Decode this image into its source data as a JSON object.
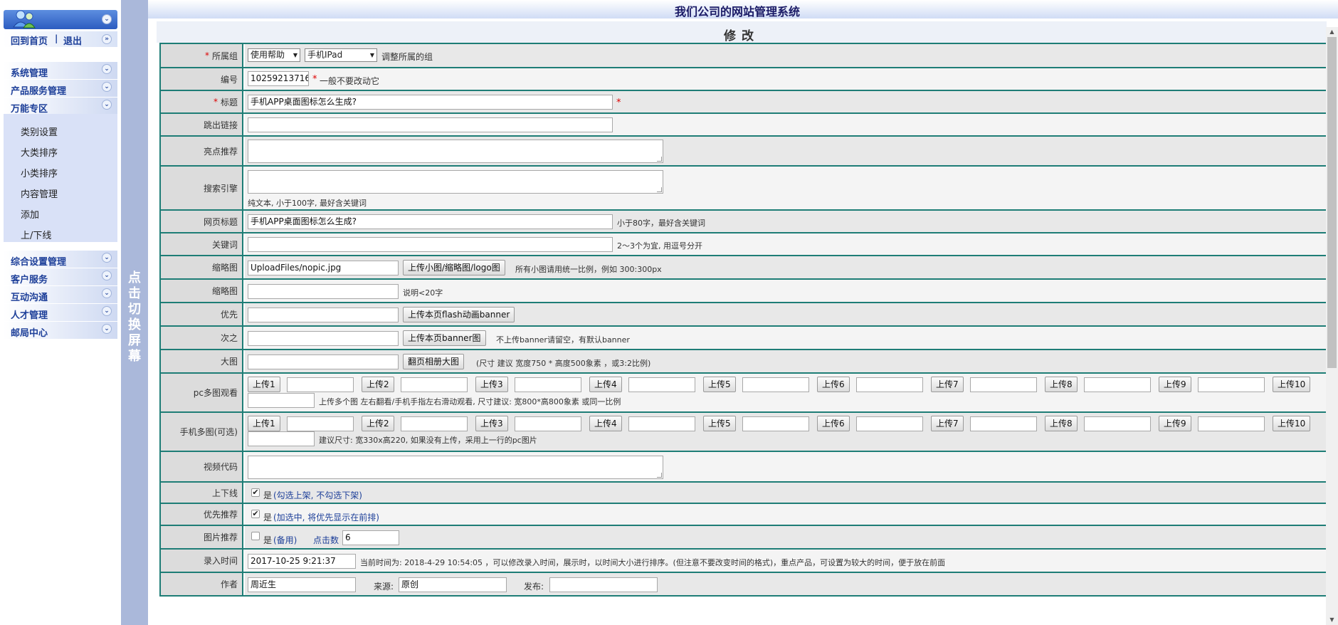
{
  "sidebar": {
    "back_home": "回到首页",
    "sep": "|",
    "logout": "退出",
    "menus": [
      "系统管理",
      "产品服务管理",
      "万能专区"
    ],
    "sub_items": [
      "类别设置",
      "大类排序",
      "小类排序",
      "内容管理",
      "添加",
      "上/下线"
    ],
    "menus2": [
      "综合设置管理",
      "客户服务",
      "互动沟通",
      "人才管理",
      "邮局中心"
    ],
    "toggle_glyph": "»"
  },
  "splitter": {
    "label": "点击切换屏幕"
  },
  "header": {
    "title": "我们公司的网站管理系统",
    "subtitle": "修改"
  },
  "form": {
    "group": {
      "label": "所属组",
      "select1": "使用帮助",
      "select2": "手机IPad",
      "note": "调整所属的组"
    },
    "code": {
      "label": "编号",
      "value": "10259213716",
      "note": "一般不要改动它"
    },
    "title": {
      "label": "标题",
      "value": "手机APP桌面图标怎么生成?"
    },
    "jump": {
      "label": "跳出链接",
      "value": ""
    },
    "highlight": {
      "label": "亮点推荐"
    },
    "seo": {
      "label": "搜索引擎",
      "note": "纯文本, 小于100字, 最好含关键词"
    },
    "page_title": {
      "label": "网页标题",
      "value": "手机APP桌面图标怎么生成?",
      "note": "小于80字，最好含关键词"
    },
    "keywords": {
      "label": "关键词",
      "value": "",
      "note": "2～3个为宜, 用逗号分开"
    },
    "thumb": {
      "label": "缩略图",
      "value": "UploadFiles/nopic.jpg",
      "button": "上传小图/缩略图/logo图",
      "note": "所有小图请用统一比例，例如 300:300px"
    },
    "thumb2": {
      "label": "缩略图",
      "value": "",
      "note": "说明<20字"
    },
    "first": {
      "label": "优先",
      "value": "",
      "button": "上传本页flash动画banner"
    },
    "second": {
      "label": "次之",
      "value": "",
      "button": "上传本页banner图",
      "note": "不上传banner请留空，有默认banner"
    },
    "big": {
      "label": "大图",
      "value": "",
      "button": "翻页相册大图",
      "note": "(尺寸 建议 宽度750 * 高度500象素 ，或3:2比例)"
    },
    "pc_multi": {
      "label": "pc多图观看",
      "buttons": [
        "上传1",
        "上传2",
        "上传3",
        "上传4",
        "上传5",
        "上传6",
        "上传7",
        "上传8",
        "上传9",
        "上传10"
      ],
      "note": "上传多个图 左右翻看/手机手指左右滑动观看, 尺寸建议: 宽800*高800象素 或同一比例"
    },
    "mobile_multi": {
      "label": "手机多图(可选)",
      "buttons": [
        "上传1",
        "上传2",
        "上传3",
        "上传4",
        "上传5",
        "上传6",
        "上传7",
        "上传8",
        "上传9",
        "上传10"
      ],
      "note": "建议尺寸: 宽330x高220, 如果没有上传，采用上一行的pc图片"
    },
    "video": {
      "label": "视频代码"
    },
    "online": {
      "label": "上下线",
      "checked": true,
      "yes": "是",
      "hint": "(勾选上架, 不勾选下架)"
    },
    "priority": {
      "label": "优先推荐",
      "checked": true,
      "yes": "是",
      "hint": "(加选中, 将优先显示在前排)"
    },
    "pic_rec": {
      "label": "图片推荐",
      "checked": false,
      "yes": "是",
      "hint": "(备用)",
      "clicks_label": "点击数",
      "clicks": "6"
    },
    "entry_time": {
      "label": "录入时间",
      "value": "2017-10-25 9:21:37",
      "note": "当前时间为: 2018-4-29 10:54:05 ，可以修改录入时间，展示时，以时间大小进行排序。(但注意不要改变时间的格式)，重点产品，可设置为较大的时间，便于放在前面"
    },
    "author": {
      "label": "作者",
      "value": "周近生",
      "source_label": "来源:",
      "source": "原创",
      "publish_label": "发布:",
      "publish": ""
    }
  },
  "required_mark": "*",
  "checkmark": "✔"
}
